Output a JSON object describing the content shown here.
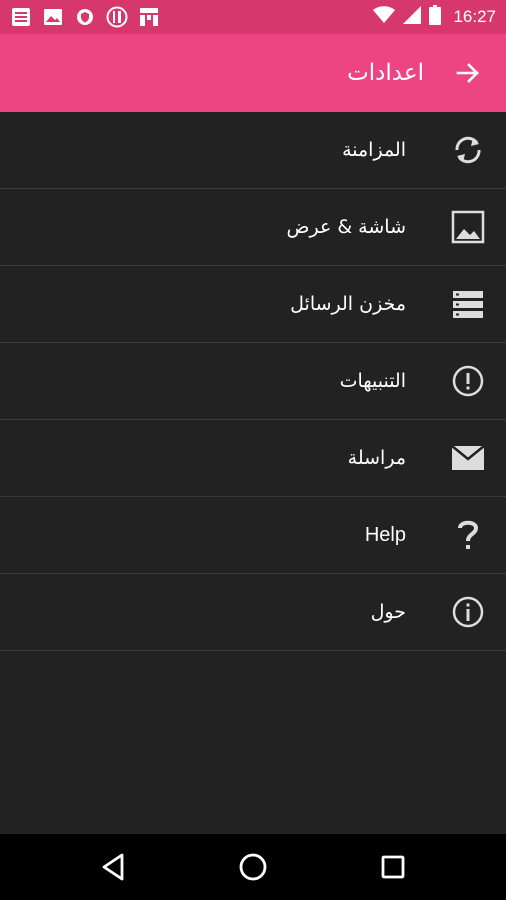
{
  "status_bar": {
    "time": "16:27",
    "left_icons": [
      "news-icon",
      "image-icon",
      "shield-icon",
      "fork-knife-icon",
      "grid-icon"
    ],
    "right_icons": [
      "wifi-icon",
      "signal-icon",
      "battery-icon"
    ]
  },
  "app_bar": {
    "title": "اعدادات",
    "back_icon": "arrow-back-icon",
    "color": "#ec4581"
  },
  "menu": {
    "items": [
      {
        "label": "المزامنة",
        "icon": "sync-icon"
      },
      {
        "label": "شاشة & عرض",
        "icon": "image-icon"
      },
      {
        "label": "مخزن الرسائل",
        "icon": "storage-icon"
      },
      {
        "label": "التنبيهات",
        "icon": "alert-circle-icon"
      },
      {
        "label": "مراسلة",
        "icon": "email-icon"
      },
      {
        "label": "Help",
        "icon": "question-icon"
      },
      {
        "label": "حول",
        "icon": "info-icon"
      }
    ]
  },
  "nav_bar": {
    "buttons": [
      "back-triangle-icon",
      "home-circle-icon",
      "recents-square-icon"
    ]
  }
}
